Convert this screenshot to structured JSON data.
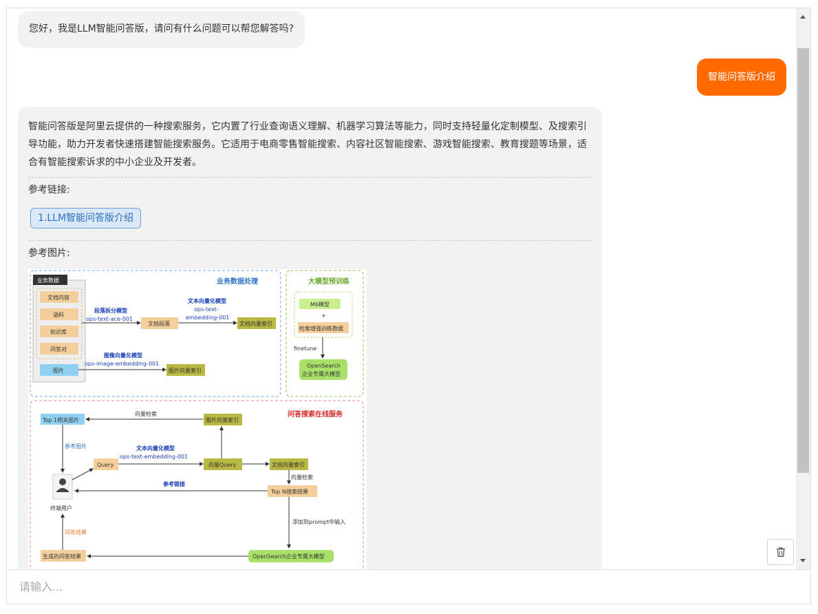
{
  "chat": {
    "greeting": "您好，我是LLM智能问答版，请问有什么问题可以帮您解答吗?",
    "user_message": "智能问答版介绍",
    "answer": {
      "paragraph": "智能问答版是阿里云提供的一种搜索服务，它内置了行业查询语义理解、机器学习算法等能力，同时支持轻量化定制模型、及搜索引导功能，助力开发者快速搭建智能搜索服务。它适用于电商零售智能搜索、内容社区智能搜索、游戏智能搜索、教育搜题等场景，适合有智能搜索诉求的中小企业及开发者。",
      "ref_links_label": "参考链接:",
      "ref_links": [
        "1.LLM智能问答版介绍"
      ],
      "ref_images_label": "参考图片:"
    }
  },
  "diagram": {
    "section_business": "业务数据处理",
    "business_data_tag": "业务数据",
    "data_items": [
      "文档内容",
      "语料",
      "知识库",
      "问答对"
    ],
    "image_item": "图片",
    "seg_model_title": "段落拆分模型",
    "seg_model_name": "ops-text-ace-001",
    "doc_paragraph": "文档段落",
    "text_vec_title": "文本向量化模型",
    "text_vec_name_1": "ops-text-",
    "text_vec_name_2": "embedding-001",
    "doc_vec_index": "文档向量索引",
    "img_vec_title": "图像向量化模型",
    "img_vec_name": "ops-image-embedding-001",
    "img_vec_index": "图片向量索引",
    "section_pretrain": "大模型预训练",
    "m6_model": "M6模型",
    "plus": "+",
    "search_train_data": "检索增强训练数据",
    "finetune": "finetune",
    "opensearch_llm_1": "OpenSearch",
    "opensearch_llm_2": "企业专属大模型",
    "section_online": "问答搜索在线服务",
    "top1_images": "Top 1相关图片",
    "vector_search": "向量检索",
    "img_vec_index_2": "图片向量索引",
    "ref_image": "参考图片",
    "text_vec_title_2": "文本向量化模型",
    "text_vec_name_full": "ops-text-embedding-001",
    "query": "Query",
    "vector_query": "向量Query",
    "doc_vec_index_2": "文档向量索引",
    "vector_search_2": "向量检索",
    "ref_link": "参考链接",
    "topn_results": "Top N搜索结果",
    "end_user": "终端用户",
    "add_prompt": "添加到prompt中输入",
    "qa_result": "问答结果",
    "generated_answer": "生成的问答结果",
    "opensearch_llm_full": "OpenSearch企业专属大模型"
  },
  "input": {
    "placeholder": "请输入..."
  },
  "icons": {
    "clear": "trash-icon",
    "scroll_up": "scroll-up-arrow-icon",
    "scroll_down": "scroll-down-arrow-icon",
    "user": "user-avatar-icon"
  },
  "colors": {
    "accent": "#ff6a00",
    "link_bg": "#dbe8f7",
    "link_border": "#6f9fd6",
    "bubble_bg": "#f2f2f2"
  }
}
